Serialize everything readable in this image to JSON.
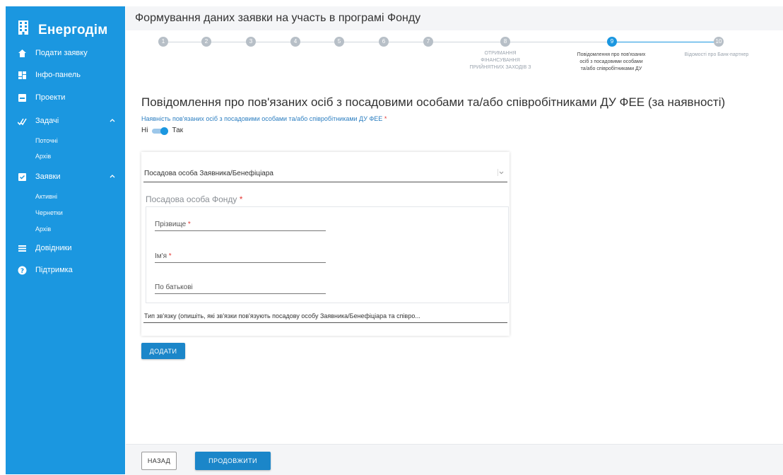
{
  "app": {
    "name": "Енергодім"
  },
  "sidebar": {
    "items": [
      {
        "label": "Подати заявку",
        "icon": "home-icon"
      },
      {
        "label": "Інфо-панель",
        "icon": "dashboard-icon"
      },
      {
        "label": "Проекти",
        "icon": "inbox-icon"
      },
      {
        "label": "Задачі",
        "icon": "checkmarks-icon",
        "expanded": true,
        "children": [
          "Поточні",
          "Архів"
        ]
      },
      {
        "label": "Заявки",
        "icon": "checkbox-icon",
        "expanded": true,
        "children": [
          "Активні",
          "Чернетки",
          "Архів"
        ]
      },
      {
        "label": "Довідники",
        "icon": "list-icon"
      },
      {
        "label": "Підтримка",
        "icon": "help-icon"
      }
    ]
  },
  "header": {
    "title": "Формування даних заявки на участь в програмі Фонду"
  },
  "stepper": {
    "steps": [
      "1",
      "2",
      "3",
      "4",
      "5",
      "6",
      "7",
      "8",
      "9",
      "10"
    ],
    "active_index": 8,
    "labels": {
      "step8": [
        "ОТРИМАННЯ",
        "ФІНАНСУВАННЯ",
        "ПРИЙНЯТНИХ ЗАХОДІВ З"
      ],
      "step9": [
        "Повідомлення про пов'язаних",
        "осіб з посадовими особами",
        "та/або співробітниками ДУ"
      ],
      "step10": [
        "Відомості про Банк-партнер"
      ]
    }
  },
  "form": {
    "heading": "Повідомлення про пов'язаних осіб з посадовими особами та/або співробітниками ДУ ФЕЕ (за наявності)",
    "presence_label": "Наявність пов'язаних осіб з посадовими особами та/або співробітниками ДУ ФЕЕ",
    "required_mark": "*",
    "toggle_off": "Ні",
    "toggle_on": "Так",
    "toggle_value": true,
    "select_value": "Посадова особа Заявника/Бенефіціара",
    "section_title": "Посадова особа Фонду",
    "fields": {
      "surname": "Прізвище",
      "name": "Ім'я",
      "patronymic": "По батькові"
    },
    "relation_placeholder": "Тип зв'язку (опишіть, які зв'язки пов'язують посадову особу Заявника/Бенефіціара та співро...",
    "add_button": "ДОДАТИ"
  },
  "footer": {
    "back_button": "НАЗАД",
    "continue_button": "ПРОДОВЖИТИ"
  },
  "colors": {
    "primary": "#1b97e0",
    "button": "#1b86c9",
    "required": "#e53935",
    "link": "#2d7fc1"
  }
}
